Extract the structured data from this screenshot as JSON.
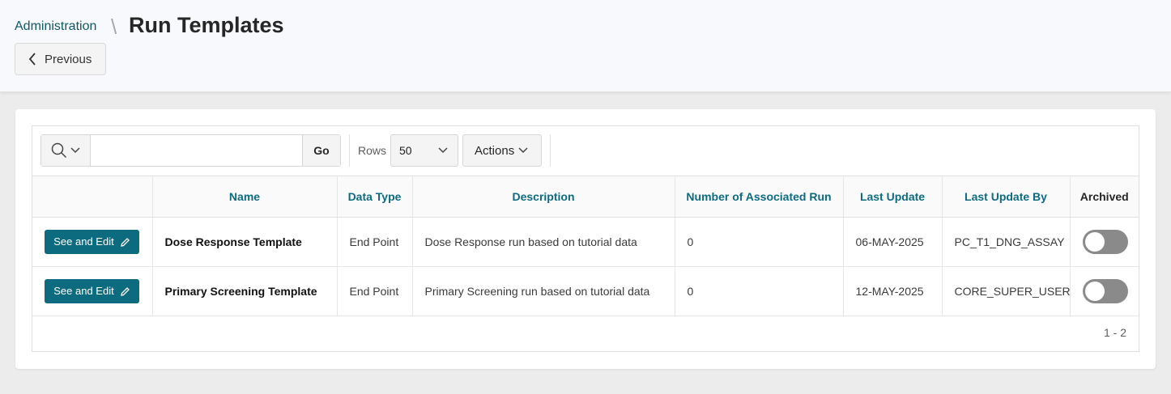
{
  "header": {
    "breadcrumb": "Administration",
    "separator": "\\",
    "title": "Run Templates",
    "previous_label": "Previous"
  },
  "toolbar": {
    "search_value": "",
    "go_label": "Go",
    "rows_label": "Rows",
    "rows_value": "50",
    "actions_label": "Actions"
  },
  "table": {
    "columns": [
      "",
      "Name",
      "Data Type",
      "Description",
      "Number of Associated Run",
      "Last Update",
      "Last Update By",
      "Archived"
    ],
    "rows": [
      {
        "edit_label": "See and Edit",
        "name": "Dose Response Template",
        "data_type": "End Point",
        "description": "Dose Response run based on tutorial data",
        "runs": "0",
        "last_update": "06-MAY-2025",
        "last_update_by": "PC_T1_DNG_ASSAY",
        "archived": false
      },
      {
        "edit_label": "See and Edit",
        "name": "Primary Screening Template",
        "data_type": "End Point",
        "description": "Primary Screening run based on tutorial data",
        "runs": "0",
        "last_update": "12-MAY-2025",
        "last_update_by": "CORE_SUPER_USER",
        "archived": false
      }
    ]
  },
  "pagination": "1 - 2",
  "colors": {
    "accent": "#0d6b80",
    "breadcrumb": "#0d5866",
    "toggle_off": "#8a8a8a"
  }
}
